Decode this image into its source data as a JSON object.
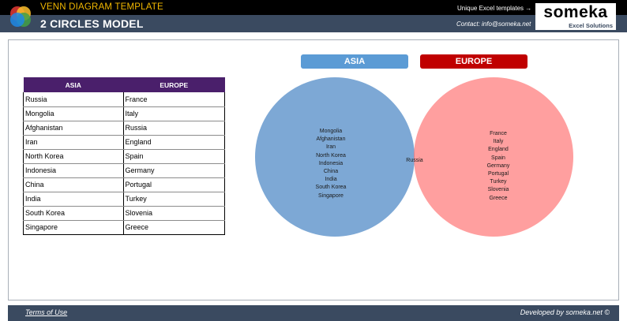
{
  "header": {
    "app_title": "VENN DIAGRAM TEMPLATE",
    "model_title": "2 CIRCLES MODEL",
    "templates_link": "Unique Excel templates →",
    "contact": "Contact: info@someka.net",
    "brand_name": "someka",
    "brand_sub": "Excel Solutions",
    "logo_colors": [
      "#e53935",
      "#fbc02d",
      "#43a047",
      "#1e88e5"
    ]
  },
  "table": {
    "headers": [
      "ASIA",
      "EUROPE"
    ],
    "header_color": "#4a1f6b",
    "rows": [
      [
        "Russia",
        "France"
      ],
      [
        "Mongolia",
        "Italy"
      ],
      [
        "Afghanistan",
        "Russia"
      ],
      [
        "Iran",
        "England"
      ],
      [
        "North Korea",
        "Spain"
      ],
      [
        "Indonesia",
        "Germany"
      ],
      [
        "China",
        "Portugal"
      ],
      [
        "India",
        "Turkey"
      ],
      [
        "South Korea",
        "Slovenia"
      ],
      [
        "Singapore",
        "Greece"
      ]
    ]
  },
  "venn": {
    "set_a_label": "ASIA",
    "set_b_label": "EUROPE",
    "set_a_color": "#6f9fd0",
    "set_b_color": "#ff6b6b",
    "only_a": [
      "Mongolia",
      "Afghanistan",
      "Iran",
      "North Korea",
      "Indonesia",
      "China",
      "India",
      "South Korea",
      "Singapore"
    ],
    "only_b": [
      "France",
      "Italy",
      "England",
      "Spain",
      "Germany",
      "Portugal",
      "Turkey",
      "Slovenia",
      "Greece"
    ],
    "intersection": [
      "Russia"
    ]
  },
  "footer": {
    "terms": "Terms of Use",
    "developed_by": "Developed by someka.net ©"
  }
}
